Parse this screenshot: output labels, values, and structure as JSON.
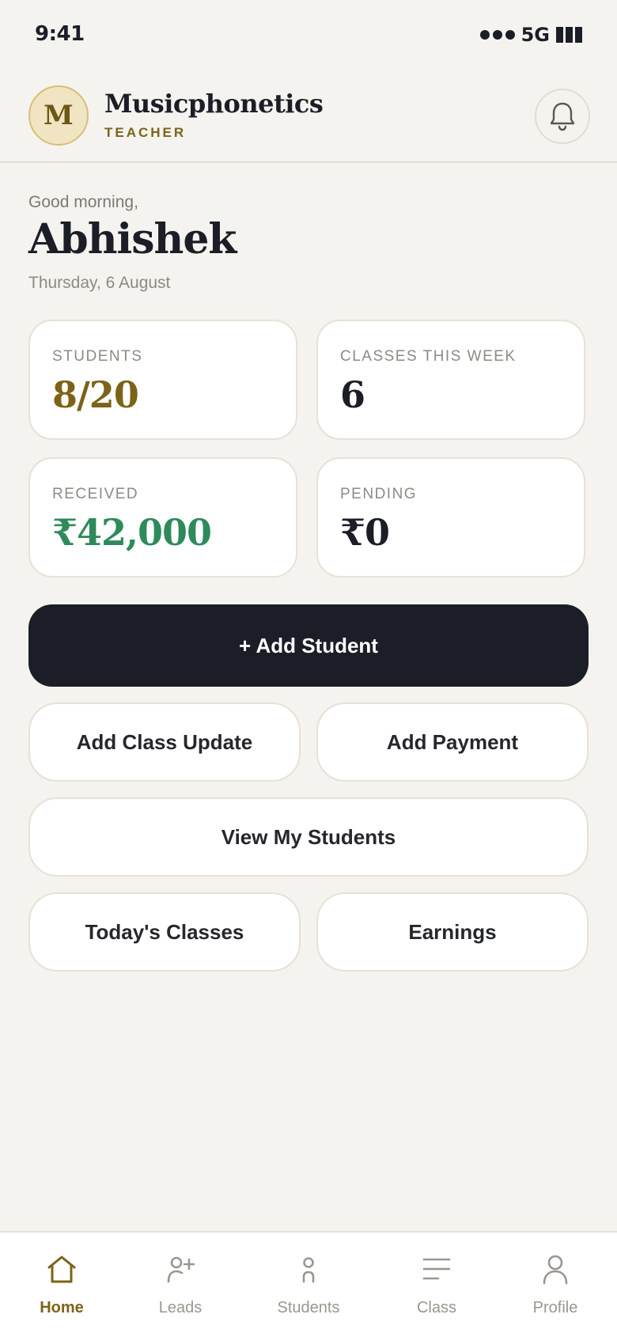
{
  "status_bar": {
    "time": "9:41",
    "network": "5G"
  },
  "header": {
    "avatar_letter": "M",
    "brand": "Musicphonetics",
    "role": "TEACHER",
    "bell_icon": "bell-icon"
  },
  "greeting": {
    "salutation": "Good morning,",
    "name": "Abhishek",
    "date": "Thursday, 6 August"
  },
  "stats": [
    {
      "label": "STUDENTS",
      "value": "8/20",
      "color": "#7c6318"
    },
    {
      "label": "CLASSES THIS WEEK",
      "value": "6",
      "color": "#1b1e27"
    },
    {
      "label": "RECEIVED",
      "value": "₹42,000",
      "color": "#2e8a5a"
    },
    {
      "label": "PENDING",
      "value": "₹0",
      "color": "#1b1e27"
    }
  ],
  "actions": {
    "add_student": "+ Add Student",
    "add_class_update": "Add Class Update",
    "add_payment": "Add Payment",
    "view_students": "View My Students",
    "todays_classes": "Today's Classes",
    "earnings": "Earnings"
  },
  "tab_bar": {
    "items": [
      {
        "label": "Home",
        "icon": "home-icon",
        "active": true
      },
      {
        "label": "Leads",
        "icon": "add-person-icon",
        "active": false
      },
      {
        "label": "Students",
        "icon": "person-icon",
        "active": false
      },
      {
        "label": "Class",
        "icon": "menu-lines-icon",
        "active": false
      },
      {
        "label": "Profile",
        "icon": "profile-icon",
        "active": false
      }
    ]
  },
  "colors": {
    "background": "#f5f3ef",
    "accent": "#7c6318",
    "dark": "#1b1e27",
    "success": "#2e8a5a"
  }
}
